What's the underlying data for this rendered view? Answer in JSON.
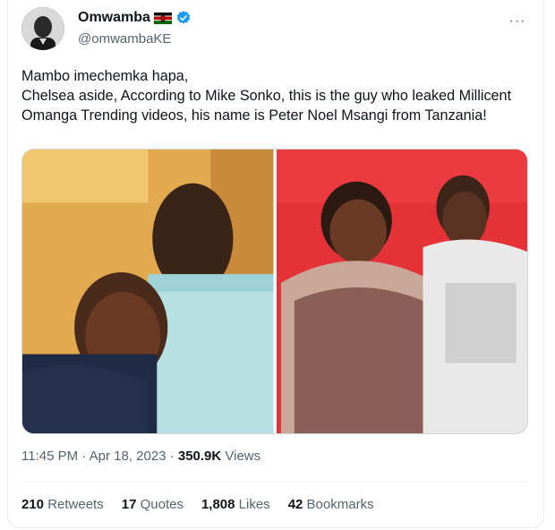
{
  "tweet": {
    "display_name": "Omwamba",
    "handle": "@omwambaKE",
    "more_label": "···",
    "text": "Mambo imechemka hapa,\nChelsea aside, According to Mike Sonko, this is the guy who leaked Millicent Omanga Trending videos, his name is Peter Noel Msangi from Tanzania!",
    "time": "11:45 PM",
    "date": "Apr 18, 2023",
    "separator": " · ",
    "views_count": "350.9K",
    "views_label": " Views"
  },
  "stats": [
    {
      "count": "210",
      "label": " Retweets"
    },
    {
      "count": "17",
      "label": " Quotes"
    },
    {
      "count": "1,808",
      "label": " Likes"
    },
    {
      "count": "42",
      "label": " Bookmarks"
    }
  ],
  "colors": {
    "text_primary": "#0f1419",
    "text_secondary": "#536471",
    "verified_blue": "#1d9bf0",
    "border": "#cfd9de"
  },
  "icons": {
    "flag": "kenya-flag-icon",
    "verified": "verified-badge-icon",
    "more": "more-icon"
  }
}
